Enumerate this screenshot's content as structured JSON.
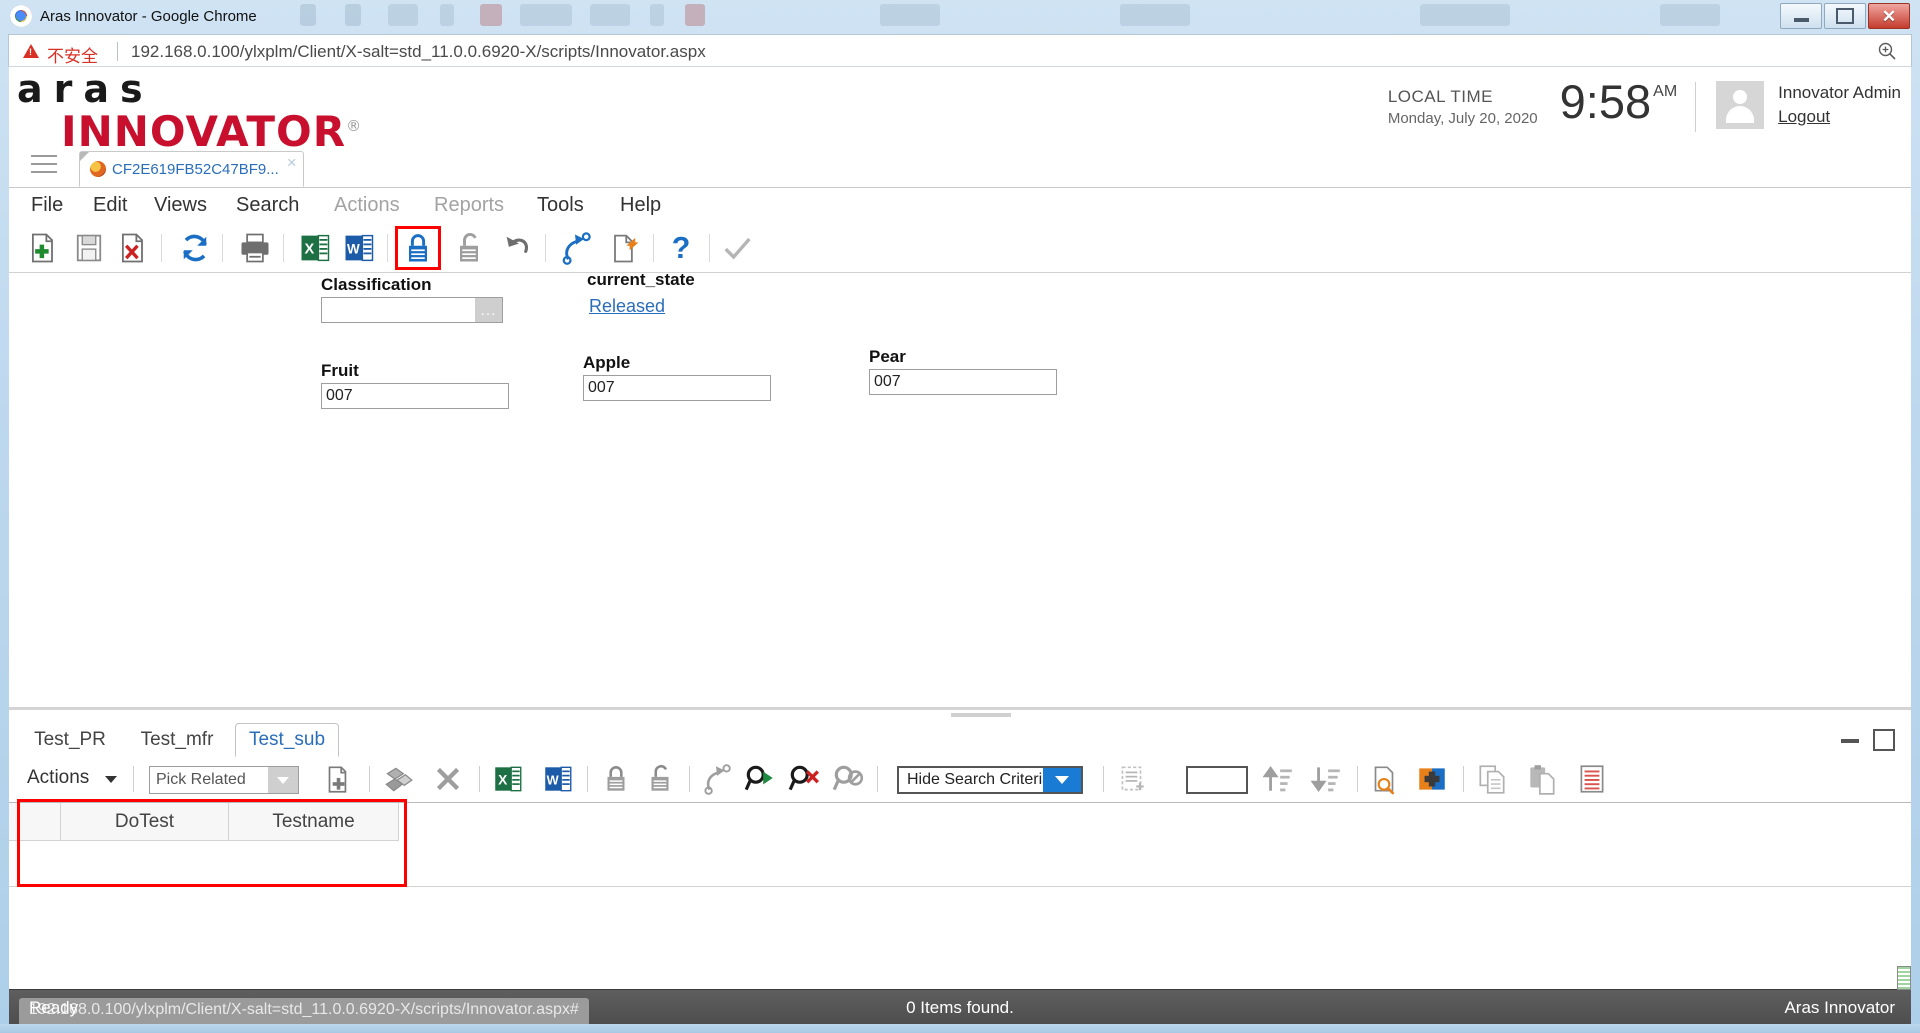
{
  "browser": {
    "window_title": "Aras Innovator - Google Chrome",
    "security_warning": "不安全",
    "url": "192.168.0.100/ylxplm/Client/X-salt=std_11.0.0.6920-X/scripts/Innovator.aspx",
    "zoom_icon": "zoom-in-icon",
    "window_controls": {
      "minimize": "minimize",
      "maximize": "restore",
      "close": "close"
    }
  },
  "header": {
    "logo_top": "aras",
    "logo_bottom": "INNOVATOR",
    "logo_reg": "®",
    "local_time_label": "LOCAL TIME",
    "local_date": "Monday, July 20, 2020",
    "time": "9:58",
    "meridiem": "AM",
    "user_name": "Innovator Admin",
    "logout_label": "Logout"
  },
  "doc_tab": {
    "label": "CF2E619FB52C47BF9...",
    "close_glyph": "×",
    "menu_icon": "hamburger-menu-icon"
  },
  "menubar": {
    "items": [
      {
        "label": "File",
        "enabled": true
      },
      {
        "label": "Edit",
        "enabled": true
      },
      {
        "label": "Views",
        "enabled": true
      },
      {
        "label": "Search",
        "enabled": true
      },
      {
        "label": "Actions",
        "enabled": false
      },
      {
        "label": "Reports",
        "enabled": false
      },
      {
        "label": "Tools",
        "enabled": true
      },
      {
        "label": "Help",
        "enabled": true
      }
    ]
  },
  "toolbar": {
    "items": [
      {
        "name": "new-item-icon",
        "tooltip": "New"
      },
      {
        "name": "save-icon",
        "tooltip": "Save"
      },
      {
        "name": "delete-item-icon",
        "tooltip": "Delete"
      },
      {
        "name": "refresh-icon",
        "tooltip": "Refresh"
      },
      {
        "name": "print-icon",
        "tooltip": "Print"
      },
      {
        "name": "export-excel-icon",
        "tooltip": "Export to Excel"
      },
      {
        "name": "export-word-icon",
        "tooltip": "Export to Word"
      },
      {
        "name": "lock-icon",
        "tooltip": "Lock"
      },
      {
        "name": "unlock-icon",
        "tooltip": "Unlock"
      },
      {
        "name": "undo-icon",
        "tooltip": "Undo"
      },
      {
        "name": "promote-icon",
        "tooltip": "Promote"
      },
      {
        "name": "copy-version-icon",
        "tooltip": "New Version"
      },
      {
        "name": "help-icon",
        "tooltip": "Help"
      },
      {
        "name": "done-check-icon",
        "tooltip": "Done"
      }
    ],
    "highlight": "lock-icon"
  },
  "form": {
    "classification": {
      "label": "Classification",
      "value": "",
      "picker_glyph": "..."
    },
    "current_state": {
      "label": "current_state",
      "value": "Released"
    },
    "fruit": {
      "label": "Fruit",
      "value": "007"
    },
    "apple": {
      "label": "Apple",
      "value": "007"
    },
    "pear": {
      "label": "Pear",
      "value": "007"
    }
  },
  "relationship_tabs": {
    "items": [
      {
        "label": "Test_PR",
        "active": false
      },
      {
        "label": "Test_mfr",
        "active": false
      },
      {
        "label": "Test_sub",
        "active": true
      }
    ],
    "minimize_icon": "panel-minimize-icon",
    "maximize_icon": "panel-maximize-icon"
  },
  "relationship_toolbar": {
    "actions_label": "Actions",
    "pick_related_label": "Pick Related",
    "hide_search_criteria_label": "Hide Search Criteria",
    "page_size_value": "",
    "items": [
      {
        "name": "create-relationship-icon"
      },
      {
        "name": "related-items-icon"
      },
      {
        "name": "delete-relationship-icon"
      },
      {
        "name": "export-excel-icon"
      },
      {
        "name": "export-word-icon"
      },
      {
        "name": "lock-icon"
      },
      {
        "name": "unlock-icon"
      },
      {
        "name": "promote-icon"
      },
      {
        "name": "run-search-icon"
      },
      {
        "name": "clear-search-icon"
      },
      {
        "name": "disable-search-icon"
      },
      {
        "name": "select-page-icon"
      },
      {
        "name": "sort-ascending-icon"
      },
      {
        "name": "sort-descending-icon"
      },
      {
        "name": "search-item-icon"
      },
      {
        "name": "add-item-icon"
      },
      {
        "name": "copy-icon"
      },
      {
        "name": "paste-icon"
      },
      {
        "name": "edit-grid-icon"
      }
    ]
  },
  "grid": {
    "columns": [
      "",
      "DoTest",
      "Testname"
    ],
    "rows": []
  },
  "statusbar": {
    "ready_text": "Ready",
    "link_preview": "192.168.0.100/ylxplm/Client/X-salt=std_11.0.0.6920-X/scripts/Innovator.aspx#",
    "items_found": "0 Items found.",
    "brand": "Aras Innovator"
  },
  "annotations": {
    "highlights": [
      {
        "name": "lock-toolbar-button-highlight",
        "color": "#ff0000"
      },
      {
        "name": "grid-header-highlight",
        "color": "#ff0000"
      }
    ]
  }
}
